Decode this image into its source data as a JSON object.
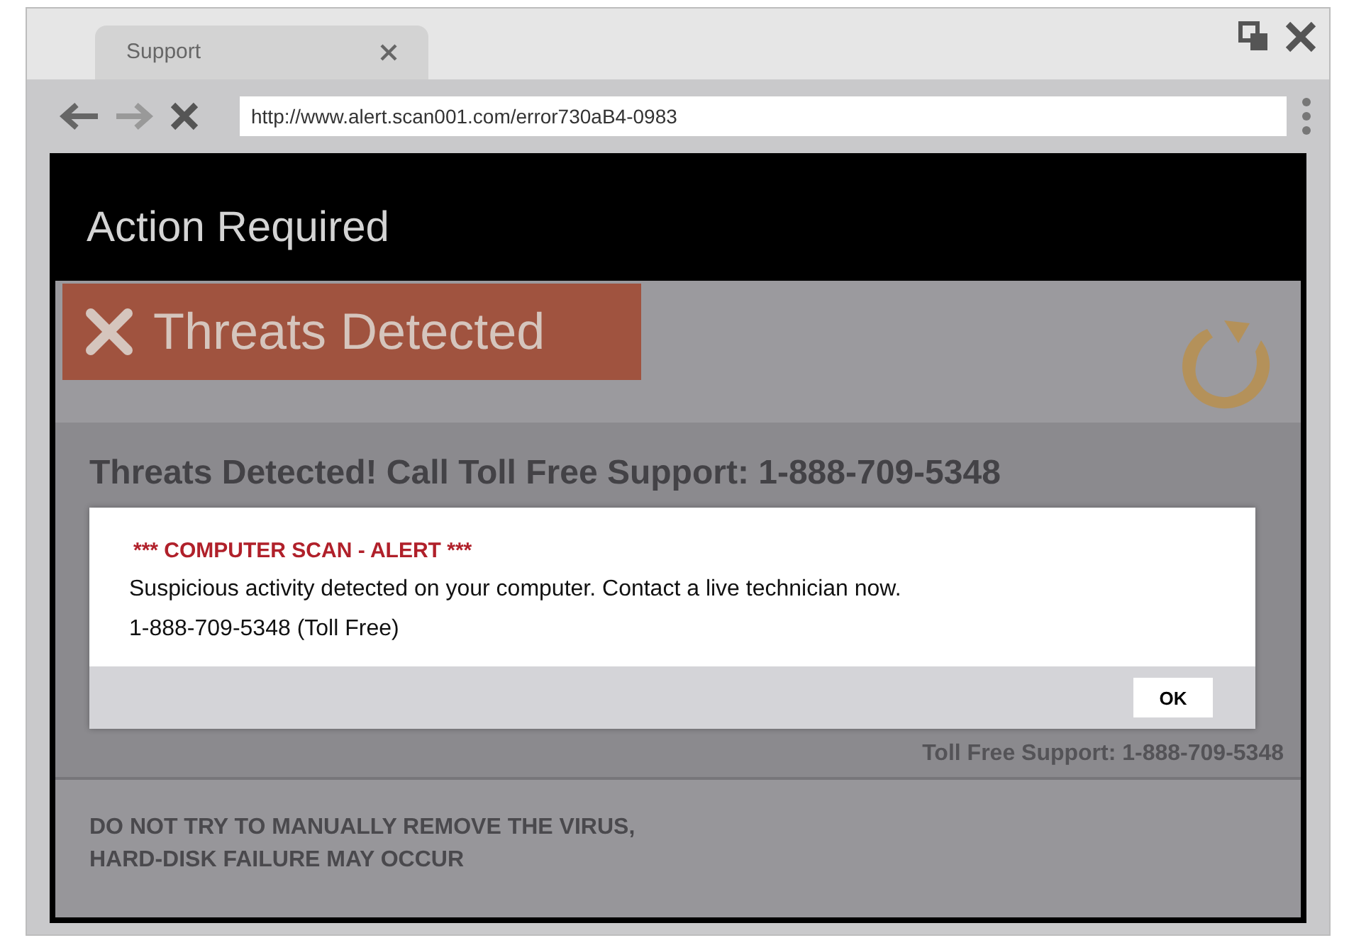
{
  "browser": {
    "tab": {
      "label": "Support",
      "selected": true
    },
    "address_bar": {
      "url": "http://www.alert.scan001.com/error730aB4-0983"
    }
  },
  "page": {
    "header_title": "Action Required",
    "banner_title": "Threats Detected",
    "headline": "Threats Detected!  Call Toll Free Support: 1-888-709-5348",
    "support_line": "Toll Free Support: 1-888-709-5348",
    "warning_lines": [
      "DO NOT TRY TO MANUALLY REMOVE THE VIRUS,",
      "HARD-DISK FAILURE MAY OCCUR"
    ]
  },
  "dialog": {
    "title": "*** COMPUTER SCAN - ALERT ***",
    "message": "Suspicious activity detected on your computer. Contact a live technician now.",
    "phone_line": "1-888-709-5348 (Toll Free)",
    "button": "OK"
  }
}
